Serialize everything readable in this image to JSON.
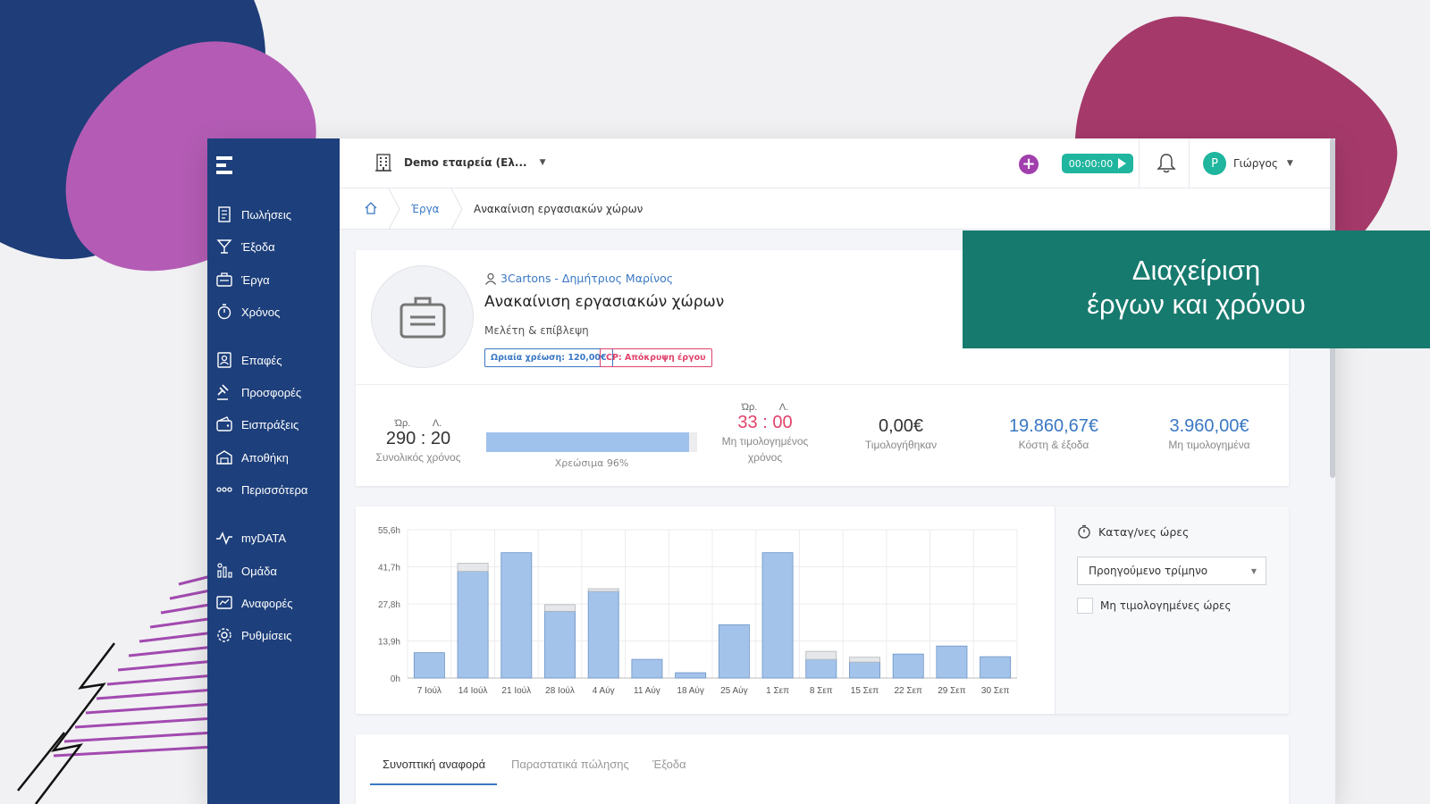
{
  "sidebar": {
    "items": [
      {
        "label": "Πωλήσεις",
        "icon": "receipt-icon"
      },
      {
        "label": "Έξοδα",
        "icon": "cocktail-icon"
      },
      {
        "label": "Έργα",
        "icon": "briefcase-icon"
      },
      {
        "label": "Χρόνος",
        "icon": "stopwatch-icon"
      },
      {
        "label": "Επαφές",
        "icon": "contacts-icon"
      },
      {
        "label": "Προσφορές",
        "icon": "gavel-icon"
      },
      {
        "label": "Εισπράξεις",
        "icon": "wallet-icon"
      },
      {
        "label": "Αποθήκη",
        "icon": "warehouse-icon"
      },
      {
        "label": "Περισσότερα",
        "icon": "more-dots-icon"
      },
      {
        "label": "myDATA",
        "icon": "pulse-icon"
      },
      {
        "label": "Ομάδα",
        "icon": "team-chart-icon"
      },
      {
        "label": "Αναφορές",
        "icon": "reports-icon"
      },
      {
        "label": "Ρυθμίσεις",
        "icon": "gear-icon"
      }
    ]
  },
  "topbar": {
    "company": "Demo εταιρεία (Ελ...",
    "timer": "00:00:00",
    "user": "Γιώργος",
    "avatar_letter": "Ρ"
  },
  "breadcrumb": {
    "link": "Έργα",
    "current": "Ανακαίνιση εργασιακών χώρων"
  },
  "project": {
    "client": "3Cartons - Δημήτριος Μαρίνος",
    "title": "Ανακαίνιση εργασιακών χώρων",
    "subtitle": "Μελέτη & επίβλεψη",
    "badge_rate": "Ωριαία χρέωση: 120,00€",
    "badge_cp": "CP: Απόκρυψη έργου"
  },
  "stats": {
    "total_hours_label": "Ώρ.",
    "total_minutes_label": "Λ.",
    "total_hours": "290",
    "total_minutes": "20",
    "total_caption": "Συνολικός χρόνος",
    "billable_percent": 96,
    "billable_caption": "Χρεώσιμα 96%",
    "unbilled_hours_label": "Ώρ.",
    "unbilled_minutes_label": "Λ.",
    "unbilled_hours": "33",
    "unbilled_minutes": "00",
    "unbilled_caption_1": "Μη τιμολογημένος",
    "unbilled_caption_2": "χρόνος",
    "invoiced_value": "0,00€",
    "invoiced_caption": "Τιμολογήθηκαν",
    "costs_value": "19.860,67€",
    "costs_caption": "Κόστη & έξοδα",
    "not_invoiced_value": "3.960,00€",
    "not_invoiced_caption": "Μη τιμολογημένα",
    "colors": {
      "unbilled": "#e0436b",
      "money": "#3a78c3"
    }
  },
  "chart_data": {
    "type": "bar",
    "categories": [
      "7 Ιούλ",
      "14 Ιούλ",
      "21 Ιούλ",
      "28 Ιούλ",
      "4 Αύγ",
      "11 Αύγ",
      "18 Αύγ",
      "25 Αύγ",
      "1 Σεπ",
      "8 Σεπ",
      "15 Σεπ",
      "22 Σεπ",
      "29 Σεπ",
      "30 Σεπ"
    ],
    "series": [
      {
        "values": [
          9.5,
          40,
          47,
          25,
          32.5,
          7,
          2,
          20,
          47,
          7,
          6,
          9,
          12,
          8
        ],
        "color": "#a4c3ea"
      },
      {
        "values": [
          0,
          3,
          0,
          2.5,
          1,
          0,
          0,
          0,
          0,
          3,
          1.8,
          0,
          0,
          0
        ],
        "color": "#e6e7ea"
      }
    ],
    "yticks": [
      "55,6h",
      "41,7h",
      "27,8h",
      "13,9h",
      "0h"
    ],
    "ylim": [
      0,
      55.6
    ],
    "grid": true,
    "stacked": true
  },
  "chart_side": {
    "title": "Καταγ/νες ώρες",
    "select_value": "Προηγούμενο τρίμηνο",
    "checkbox_label": "Μη τιμολογημένες ώρες"
  },
  "tabs": [
    "Συνοπτική αναφορά",
    "Παραστατικά πώλησης",
    "Έξοδα"
  ],
  "overlay": {
    "line1": "Διαχείριση",
    "line2": "έργων  και χρόνου",
    "color": "#177a6e"
  }
}
